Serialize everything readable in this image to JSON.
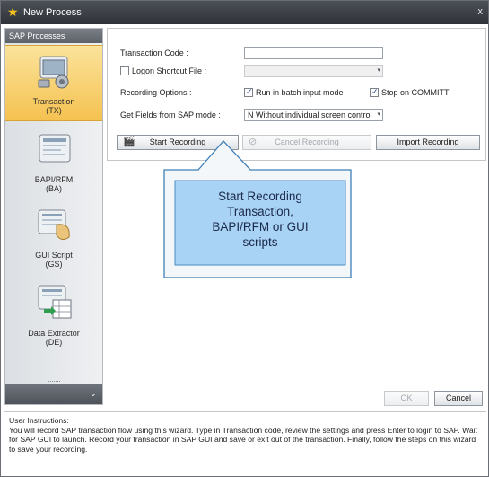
{
  "window": {
    "title": "New Process",
    "close_glyph": "x"
  },
  "sidebar": {
    "header": "SAP Processes",
    "items": [
      {
        "label": "Transaction",
        "sub": "(TX)",
        "icon": "transaction-icon",
        "selected": true
      },
      {
        "label": "BAPI/RFM",
        "sub": "(BA)",
        "icon": "bapi-icon",
        "selected": false
      },
      {
        "label": "GUI Script",
        "sub": "(GS)",
        "icon": "gui-script-icon",
        "selected": false
      },
      {
        "label": "Data Extractor",
        "sub": "(DE)",
        "icon": "data-extractor-icon",
        "selected": false
      }
    ],
    "footer_chevron": "⌄"
  },
  "form": {
    "transaction_code_label": "Transaction Code :",
    "transaction_code_value": "",
    "logon_shortcut_label": "Logon Shortcut File :",
    "logon_shortcut_value": "",
    "recording_options_label": "Recording Options  :",
    "batch_input_label": "Run in batch input mode",
    "batch_input_checked": true,
    "stop_commit_label": "Stop on COMMITT",
    "stop_commit_checked": true,
    "get_fields_label": "Get Fields from SAP mode :",
    "get_fields_value": "N Without individual screen control"
  },
  "buttons": {
    "start_recording": "Start Recording",
    "cancel_recording": "Cancel Recording",
    "import_recording": "Import Recording",
    "ok": "OK",
    "cancel": "Cancel"
  },
  "callout": {
    "line1": "Start Recording",
    "line2": "Transaction,",
    "line3": "BAPI/RFM or GUI",
    "line4": "scripts"
  },
  "instructions": {
    "title": "User Instructions:",
    "text": "You will record  SAP transaction flow using this wizard. Type in Transaction code, review the settings and press Enter to login to SAP. Wait for SAP GUI to launch. Record your transaction in SAP GUI and save or exit out of the transaction. Finally, follow the steps on this wizard to save your recording."
  },
  "colors": {
    "accent_selected": "#f5c251",
    "titlebar": "#3a3d43",
    "callout_fill": "#a9d3f5",
    "callout_border": "#3f7fb8"
  }
}
